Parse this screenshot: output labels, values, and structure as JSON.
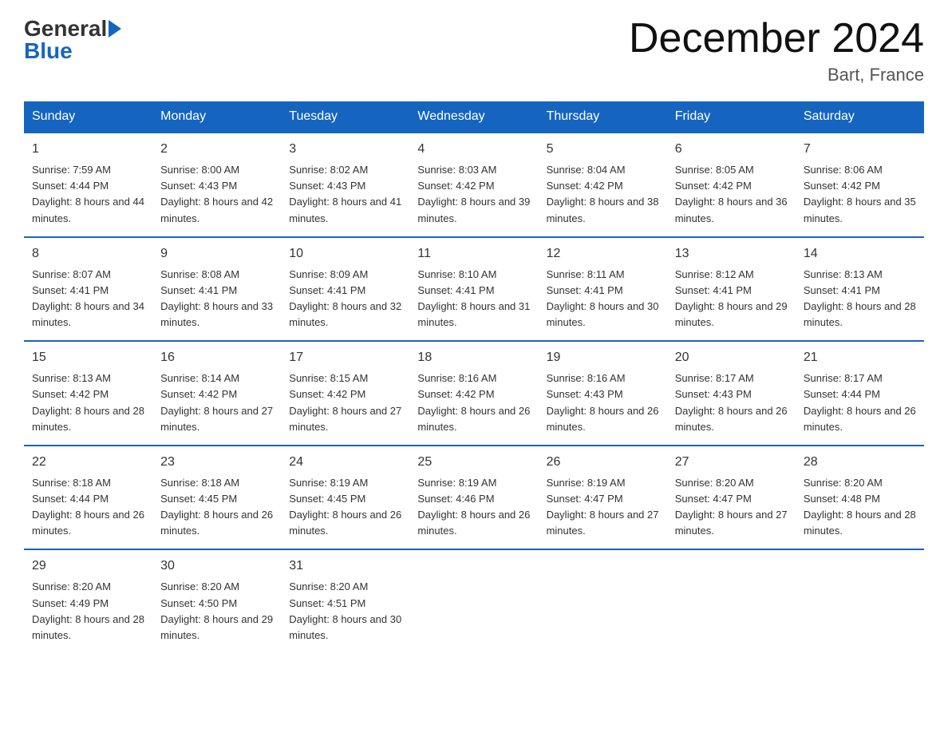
{
  "header": {
    "month_title": "December 2024",
    "location": "Bart, France"
  },
  "logo": {
    "line1": "General",
    "line2": "Blue"
  },
  "days_of_week": [
    "Sunday",
    "Monday",
    "Tuesday",
    "Wednesday",
    "Thursday",
    "Friday",
    "Saturday"
  ],
  "weeks": [
    [
      {
        "day": "1",
        "sunrise": "7:59 AM",
        "sunset": "4:44 PM",
        "daylight": "8 hours and 44 minutes."
      },
      {
        "day": "2",
        "sunrise": "8:00 AM",
        "sunset": "4:43 PM",
        "daylight": "8 hours and 42 minutes."
      },
      {
        "day": "3",
        "sunrise": "8:02 AM",
        "sunset": "4:43 PM",
        "daylight": "8 hours and 41 minutes."
      },
      {
        "day": "4",
        "sunrise": "8:03 AM",
        "sunset": "4:42 PM",
        "daylight": "8 hours and 39 minutes."
      },
      {
        "day": "5",
        "sunrise": "8:04 AM",
        "sunset": "4:42 PM",
        "daylight": "8 hours and 38 minutes."
      },
      {
        "day": "6",
        "sunrise": "8:05 AM",
        "sunset": "4:42 PM",
        "daylight": "8 hours and 36 minutes."
      },
      {
        "day": "7",
        "sunrise": "8:06 AM",
        "sunset": "4:42 PM",
        "daylight": "8 hours and 35 minutes."
      }
    ],
    [
      {
        "day": "8",
        "sunrise": "8:07 AM",
        "sunset": "4:41 PM",
        "daylight": "8 hours and 34 minutes."
      },
      {
        "day": "9",
        "sunrise": "8:08 AM",
        "sunset": "4:41 PM",
        "daylight": "8 hours and 33 minutes."
      },
      {
        "day": "10",
        "sunrise": "8:09 AM",
        "sunset": "4:41 PM",
        "daylight": "8 hours and 32 minutes."
      },
      {
        "day": "11",
        "sunrise": "8:10 AM",
        "sunset": "4:41 PM",
        "daylight": "8 hours and 31 minutes."
      },
      {
        "day": "12",
        "sunrise": "8:11 AM",
        "sunset": "4:41 PM",
        "daylight": "8 hours and 30 minutes."
      },
      {
        "day": "13",
        "sunrise": "8:12 AM",
        "sunset": "4:41 PM",
        "daylight": "8 hours and 29 minutes."
      },
      {
        "day": "14",
        "sunrise": "8:13 AM",
        "sunset": "4:41 PM",
        "daylight": "8 hours and 28 minutes."
      }
    ],
    [
      {
        "day": "15",
        "sunrise": "8:13 AM",
        "sunset": "4:42 PM",
        "daylight": "8 hours and 28 minutes."
      },
      {
        "day": "16",
        "sunrise": "8:14 AM",
        "sunset": "4:42 PM",
        "daylight": "8 hours and 27 minutes."
      },
      {
        "day": "17",
        "sunrise": "8:15 AM",
        "sunset": "4:42 PM",
        "daylight": "8 hours and 27 minutes."
      },
      {
        "day": "18",
        "sunrise": "8:16 AM",
        "sunset": "4:42 PM",
        "daylight": "8 hours and 26 minutes."
      },
      {
        "day": "19",
        "sunrise": "8:16 AM",
        "sunset": "4:43 PM",
        "daylight": "8 hours and 26 minutes."
      },
      {
        "day": "20",
        "sunrise": "8:17 AM",
        "sunset": "4:43 PM",
        "daylight": "8 hours and 26 minutes."
      },
      {
        "day": "21",
        "sunrise": "8:17 AM",
        "sunset": "4:44 PM",
        "daylight": "8 hours and 26 minutes."
      }
    ],
    [
      {
        "day": "22",
        "sunrise": "8:18 AM",
        "sunset": "4:44 PM",
        "daylight": "8 hours and 26 minutes."
      },
      {
        "day": "23",
        "sunrise": "8:18 AM",
        "sunset": "4:45 PM",
        "daylight": "8 hours and 26 minutes."
      },
      {
        "day": "24",
        "sunrise": "8:19 AM",
        "sunset": "4:45 PM",
        "daylight": "8 hours and 26 minutes."
      },
      {
        "day": "25",
        "sunrise": "8:19 AM",
        "sunset": "4:46 PM",
        "daylight": "8 hours and 26 minutes."
      },
      {
        "day": "26",
        "sunrise": "8:19 AM",
        "sunset": "4:47 PM",
        "daylight": "8 hours and 27 minutes."
      },
      {
        "day": "27",
        "sunrise": "8:20 AM",
        "sunset": "4:47 PM",
        "daylight": "8 hours and 27 minutes."
      },
      {
        "day": "28",
        "sunrise": "8:20 AM",
        "sunset": "4:48 PM",
        "daylight": "8 hours and 28 minutes."
      }
    ],
    [
      {
        "day": "29",
        "sunrise": "8:20 AM",
        "sunset": "4:49 PM",
        "daylight": "8 hours and 28 minutes."
      },
      {
        "day": "30",
        "sunrise": "8:20 AM",
        "sunset": "4:50 PM",
        "daylight": "8 hours and 29 minutes."
      },
      {
        "day": "31",
        "sunrise": "8:20 AM",
        "sunset": "4:51 PM",
        "daylight": "8 hours and 30 minutes."
      },
      {
        "day": "",
        "sunrise": "",
        "sunset": "",
        "daylight": ""
      },
      {
        "day": "",
        "sunrise": "",
        "sunset": "",
        "daylight": ""
      },
      {
        "day": "",
        "sunrise": "",
        "sunset": "",
        "daylight": ""
      },
      {
        "day": "",
        "sunrise": "",
        "sunset": "",
        "daylight": ""
      }
    ]
  ],
  "labels": {
    "sunrise_prefix": "Sunrise: ",
    "sunset_prefix": "Sunset: ",
    "daylight_prefix": "Daylight: "
  }
}
